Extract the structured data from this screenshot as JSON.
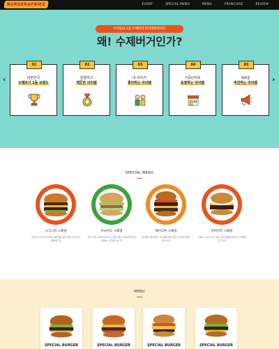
{
  "nav": {
    "logo": "BURGER&FRIEZ",
    "items": [
      "EVENT",
      "SPECIAL MENU",
      "MENU",
      "FRANCHISE",
      "REVIEW"
    ]
  },
  "hero": {
    "tagline": "우리동네 1등 수제버거 버거앤프라이즈",
    "headline": "왜! 수제버거인가?",
    "cards": [
      {
        "num": "01",
        "line1": "대한민국",
        "line2": "수제버거 1등 브랜드",
        "icon": "trophy-icon"
      },
      {
        "num": "02",
        "line1": "깔끔하고",
        "line2": "깨끗한 아이템",
        "icon": "medal-icon"
      },
      {
        "num": "03",
        "line1": "내 아이가",
        "line2": "좋아하는 아이템",
        "icon": "kids-icon"
      },
      {
        "num": "04",
        "line1": "가족단위로",
        "line2": "운영하는 아이템",
        "icon": "store-icon"
      },
      {
        "num": "05",
        "line1": "새로운",
        "line2": "추천하는 아이템",
        "icon": "megaphone-icon"
      }
    ]
  },
  "special": {
    "title": "SPECIAL MENU",
    "items": [
      {
        "name": "시그니처 스페셜",
        "desc": "자연산 버섯과 치즈와 불맛을 살린 패티가 만나 행복한 맛",
        "ring": "#e8531d"
      },
      {
        "name": "아보카도 스페셜",
        "desc": "부드러운 아보카도와 신선한 채소 토마토와 함께하는 건강한 한 끼",
        "ring": "#3aa33a"
      },
      {
        "name": "베이크트 스페셜",
        "desc": "촉촉한 베이컨과 치즈를 듬뿍 올린 고소한 풍미 가득 버거",
        "ring": "#f08a24"
      },
      {
        "name": "슈퍼치즈 스페셜",
        "desc": "100% 순소고기 패티 위에 흘러내리는 모짜렐라 치즈",
        "ring": "#e8531d"
      }
    ]
  },
  "menu": {
    "title": "MENU",
    "items": [
      "SPECIAL BURGER",
      "SPECIAL BURGER",
      "SPECIAL BURGER",
      "SPECIAL BURGER"
    ]
  },
  "colors": {
    "hero_bg": "#7fd9cf",
    "accent": "#e8531d",
    "badge": "#f9c33b",
    "menu_bg": "#fbefce"
  }
}
